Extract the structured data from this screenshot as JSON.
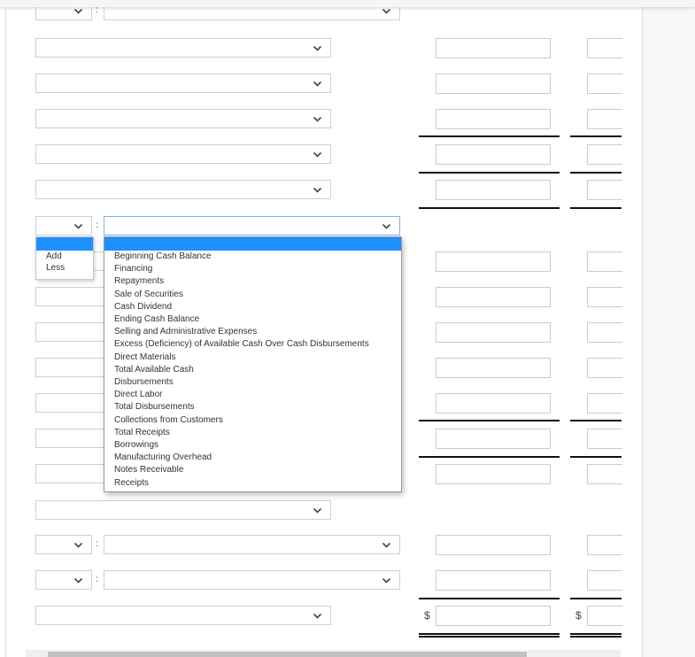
{
  "form": {
    "rows": [
      {
        "type": "pair"
      },
      {
        "type": "wide"
      },
      {
        "type": "wide"
      },
      {
        "type": "wide"
      },
      {
        "type": "wide"
      },
      {
        "type": "wide"
      },
      {
        "type": "pair-open"
      },
      {
        "type": "wide"
      },
      {
        "type": "wide"
      },
      {
        "type": "wide"
      },
      {
        "type": "wide"
      },
      {
        "type": "wide"
      },
      {
        "type": "wide"
      },
      {
        "type": "wide"
      },
      {
        "type": "wide"
      },
      {
        "type": "pair"
      },
      {
        "type": "pair"
      },
      {
        "type": "wide"
      }
    ],
    "separator": ":",
    "currency_symbol": "$"
  },
  "dropdown_add_less": {
    "selected": "",
    "options": [
      "Add",
      "Less"
    ]
  },
  "dropdown_account": {
    "selected": "",
    "options": [
      "Beginning Cash Balance",
      "Financing",
      "Repayments",
      "Sale of Securities",
      "Cash Dividend",
      "Ending Cash Balance",
      "Selling and Administrative Expenses",
      "Excess (Deficiency) of Available Cash Over Cash Disbursements",
      "Direct Materials",
      "Total Available Cash",
      "Disbursements",
      "Direct Labor",
      "Total Disbursements",
      "Collections from Customers",
      "Total Receipts",
      "Borrowings",
      "Manufacturing Overhead",
      "Notes Receivable",
      "Receipts"
    ]
  },
  "colors": {
    "highlight": "#1e90ff",
    "border": "#cccccc",
    "rule": "#111111"
  }
}
